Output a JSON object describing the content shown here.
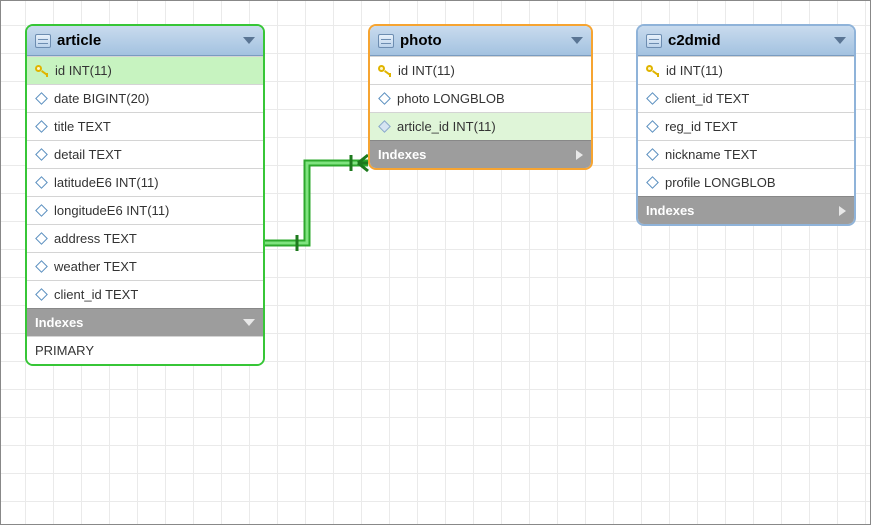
{
  "tables": {
    "article": {
      "name": "article",
      "columns": [
        {
          "label": "id INT(11)",
          "pk": true
        },
        {
          "label": "date BIGINT(20)"
        },
        {
          "label": "title TEXT"
        },
        {
          "label": "detail TEXT"
        },
        {
          "label": "latitudeE6 INT(11)"
        },
        {
          "label": "longitudeE6 INT(11)"
        },
        {
          "label": "address TEXT"
        },
        {
          "label": "weather TEXT"
        },
        {
          "label": "client_id TEXT"
        }
      ],
      "indexes_label": "Indexes",
      "index_items": [
        "PRIMARY"
      ]
    },
    "photo": {
      "name": "photo",
      "columns": [
        {
          "label": "id INT(11)",
          "pk": true
        },
        {
          "label": "photo LONGBLOB"
        },
        {
          "label": "article_id INT(11)",
          "fk": true
        }
      ],
      "indexes_label": "Indexes"
    },
    "c2dmid": {
      "name": "c2dmid",
      "columns": [
        {
          "label": "id INT(11)",
          "pk": true
        },
        {
          "label": "client_id TEXT"
        },
        {
          "label": "reg_id TEXT"
        },
        {
          "label": "nickname TEXT"
        },
        {
          "label": "profile LONGBLOB"
        }
      ],
      "indexes_label": "Indexes"
    }
  },
  "relationship": {
    "from": "article.id",
    "to": "photo.article_id",
    "cardinality": "one-to-many"
  }
}
